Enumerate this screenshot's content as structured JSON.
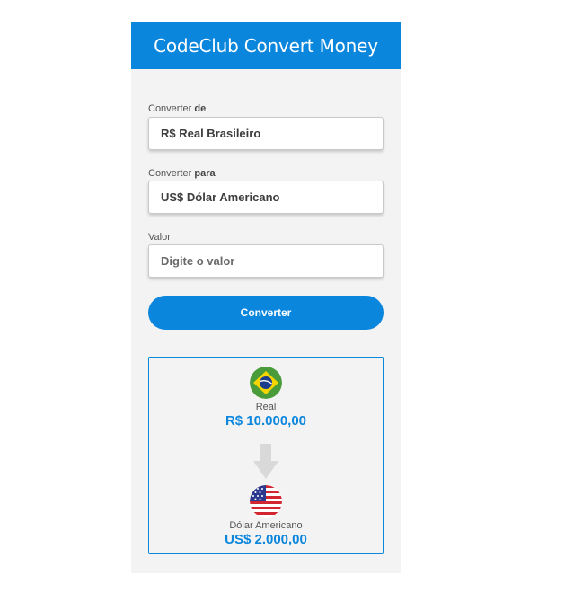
{
  "header": {
    "title": "CodeClub Convert Money"
  },
  "form": {
    "from_label_prefix": "Converter ",
    "from_label_bold": "de",
    "from_selected": "R$ Real Brasileiro",
    "to_label_prefix": "Converter ",
    "to_label_bold": "para",
    "to_selected": "US$ Dólar Americano",
    "value_label": "Valor",
    "value_placeholder": "Digite o valor",
    "value_current": "",
    "convert_label": "Converter"
  },
  "result": {
    "from": {
      "flag_icon": "brazil-flag-icon",
      "name": "Real",
      "value": "R$ 10.000,00"
    },
    "arrow_icon": "arrow-down-icon",
    "to": {
      "flag_icon": "usa-flag-icon",
      "name": "Dólar Americano",
      "value": "US$ 2.000,00"
    }
  },
  "colors": {
    "accent": "#0b86dd",
    "panel_bg": "#f3f3f3",
    "brazil_green": "#4a9b3a",
    "brazil_yellow": "#f4d500",
    "brazil_blue": "#1c3c8c",
    "usa_red": "#d22630",
    "usa_blue": "#2b3a8f",
    "arrow_gray": "#d9d9d9"
  }
}
